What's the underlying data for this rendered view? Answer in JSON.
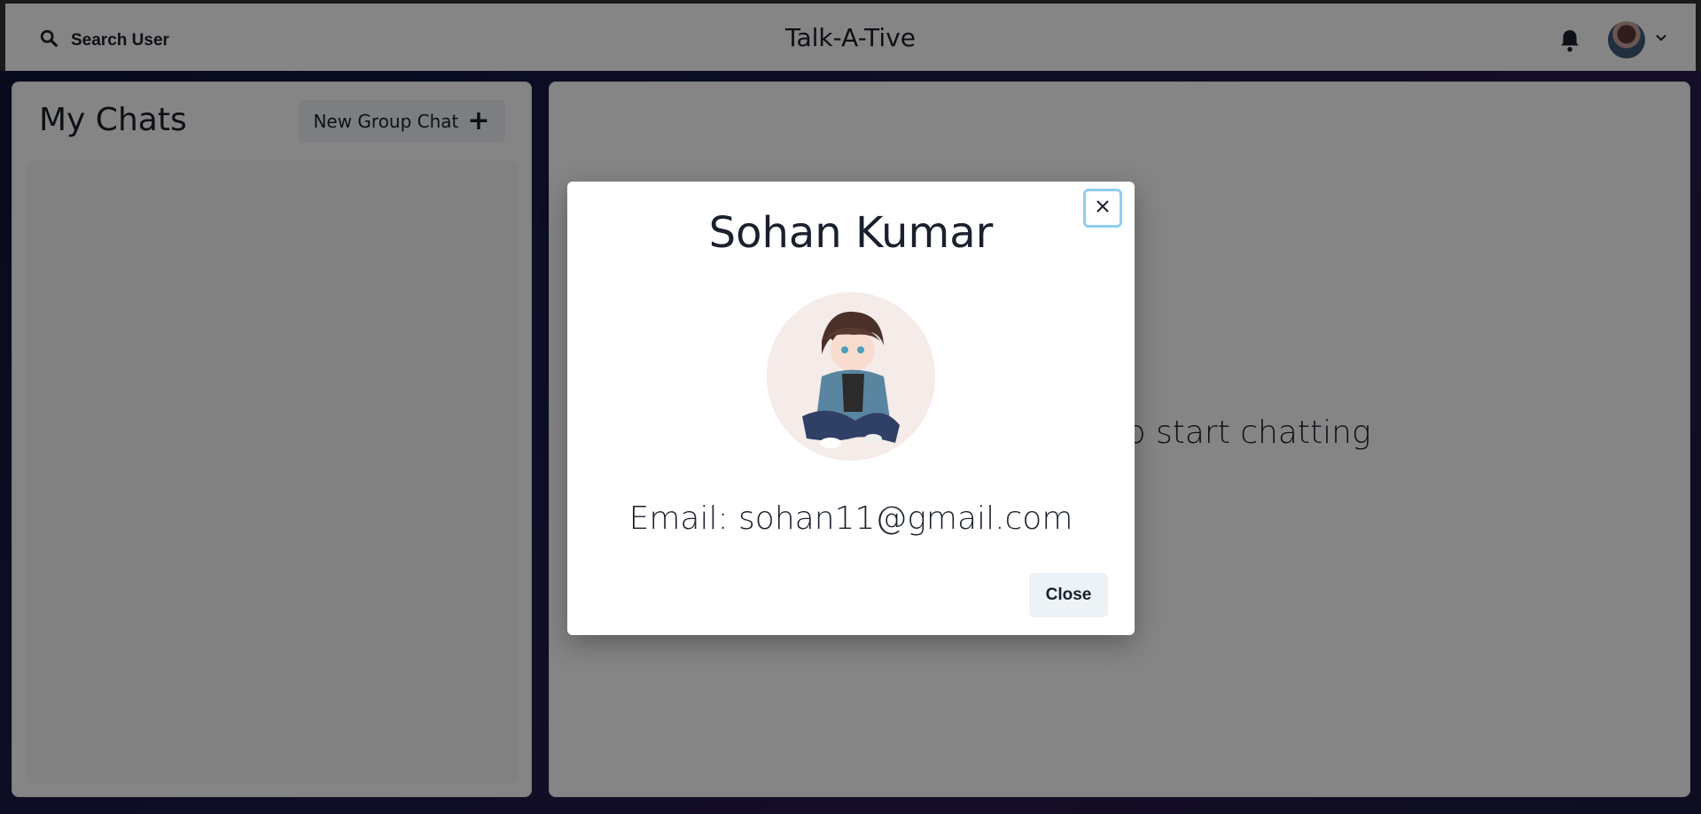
{
  "header": {
    "search_label": "Search User",
    "app_title": "Talk-A-Tive"
  },
  "sidebar": {
    "title": "My Chats",
    "new_group_label": "New Group Chat"
  },
  "chatbox": {
    "placeholder": "Click on a user to start chatting"
  },
  "modal": {
    "title": "Sohan Kumar",
    "email": "Email: sohan11@gmail.com",
    "close_label": "Close"
  },
  "icons": {
    "search": "search-icon",
    "bell": "bell-icon",
    "chevron": "chevron-down-icon",
    "plus": "plus-icon",
    "close": "close-icon"
  }
}
